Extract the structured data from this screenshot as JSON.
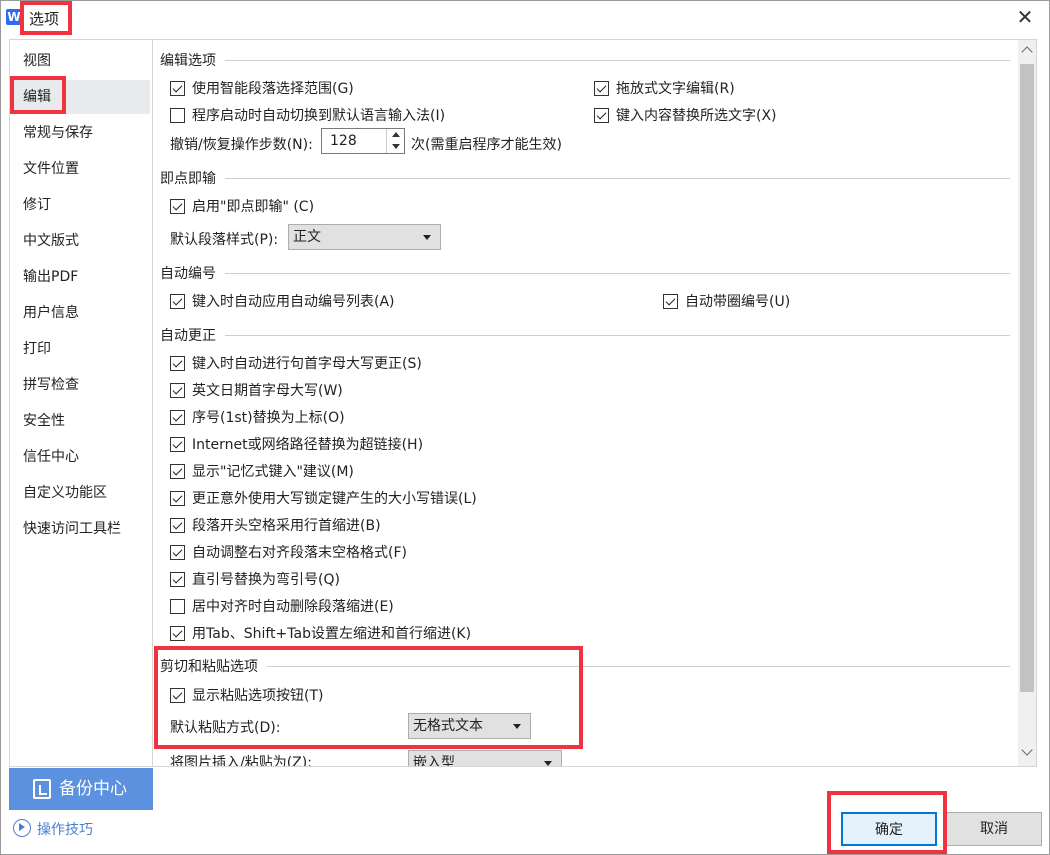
{
  "window": {
    "title": "选项",
    "logo": "W"
  },
  "sidebar": {
    "items": [
      {
        "label": "视图"
      },
      {
        "label": "编辑"
      },
      {
        "label": "常规与保存"
      },
      {
        "label": "文件位置"
      },
      {
        "label": "修订"
      },
      {
        "label": "中文版式"
      },
      {
        "label": "输出PDF"
      },
      {
        "label": "用户信息"
      },
      {
        "label": "打印"
      },
      {
        "label": "拼写检查"
      },
      {
        "label": "安全性"
      },
      {
        "label": "信任中心"
      },
      {
        "label": "自定义功能区"
      },
      {
        "label": "快速访问工具栏"
      }
    ],
    "active": "编辑",
    "backup_label": "备份中心",
    "tips_label": "操作技巧"
  },
  "sections": {
    "edit": {
      "title": "编辑选项",
      "smart_para": {
        "label": "使用智能段落选择范围(G)",
        "checked": true
      },
      "drag_edit": {
        "label": "拖放式文字编辑(R)",
        "checked": true
      },
      "auto_ime": {
        "label": "程序启动时自动切换到默认语言输入法(I)",
        "checked": false
      },
      "replace_sel": {
        "label": "键入内容替换所选文字(X)",
        "checked": true
      },
      "undo_label": "撤销/恢复操作步数(N):",
      "undo_value": "128",
      "undo_note": "次(需重启程序才能生效)"
    },
    "click_type": {
      "title": "即点即输",
      "enable": {
        "label": "启用\"即点即输\" (C)",
        "checked": true
      },
      "style_label": "默认段落样式(P):",
      "style_value": "正文"
    },
    "auto_number": {
      "title": "自动编号",
      "auto_list": {
        "label": "键入时自动应用自动编号列表(A)",
        "checked": true
      },
      "circle": {
        "label": "自动带圈编号(U)",
        "checked": true
      }
    },
    "auto_correct": {
      "title": "自动更正",
      "items": [
        {
          "label": "键入时自动进行句首字母大写更正(S)",
          "checked": true
        },
        {
          "label": "英文日期首字母大写(W)",
          "checked": true
        },
        {
          "label": "序号(1st)替换为上标(O)",
          "checked": true
        },
        {
          "label": "Internet或网络路径替换为超链接(H)",
          "checked": true
        },
        {
          "label": "显示\"记忆式键入\"建议(M)",
          "checked": true
        },
        {
          "label": "更正意外使用大写锁定键产生的大小写错误(L)",
          "checked": true
        },
        {
          "label": "段落开头空格采用行首缩进(B)",
          "checked": true
        },
        {
          "label": "自动调整右对齐段落末空格格式(F)",
          "checked": true
        },
        {
          "label": "直引号替换为弯引号(Q)",
          "checked": true
        },
        {
          "label": "居中对齐时自动删除段落缩进(E)",
          "checked": false
        },
        {
          "label": "用Tab、Shift+Tab设置左缩进和首行缩进(K)",
          "checked": true
        }
      ]
    },
    "paste": {
      "title": "剪切和粘贴选项",
      "show_btn": {
        "label": "显示粘贴选项按钮(T)",
        "checked": true
      },
      "paste_label": "默认粘贴方式(D):",
      "paste_value": "无格式文本",
      "image_label": "将图片插入/粘贴为(Z):",
      "image_value": "嵌入型"
    }
  },
  "footer": {
    "ok_label": "确定",
    "cancel_label": "取消"
  },
  "colors": {
    "highlight": "#ef3340",
    "accent": "#5b91de",
    "focus": "#0078d7"
  }
}
